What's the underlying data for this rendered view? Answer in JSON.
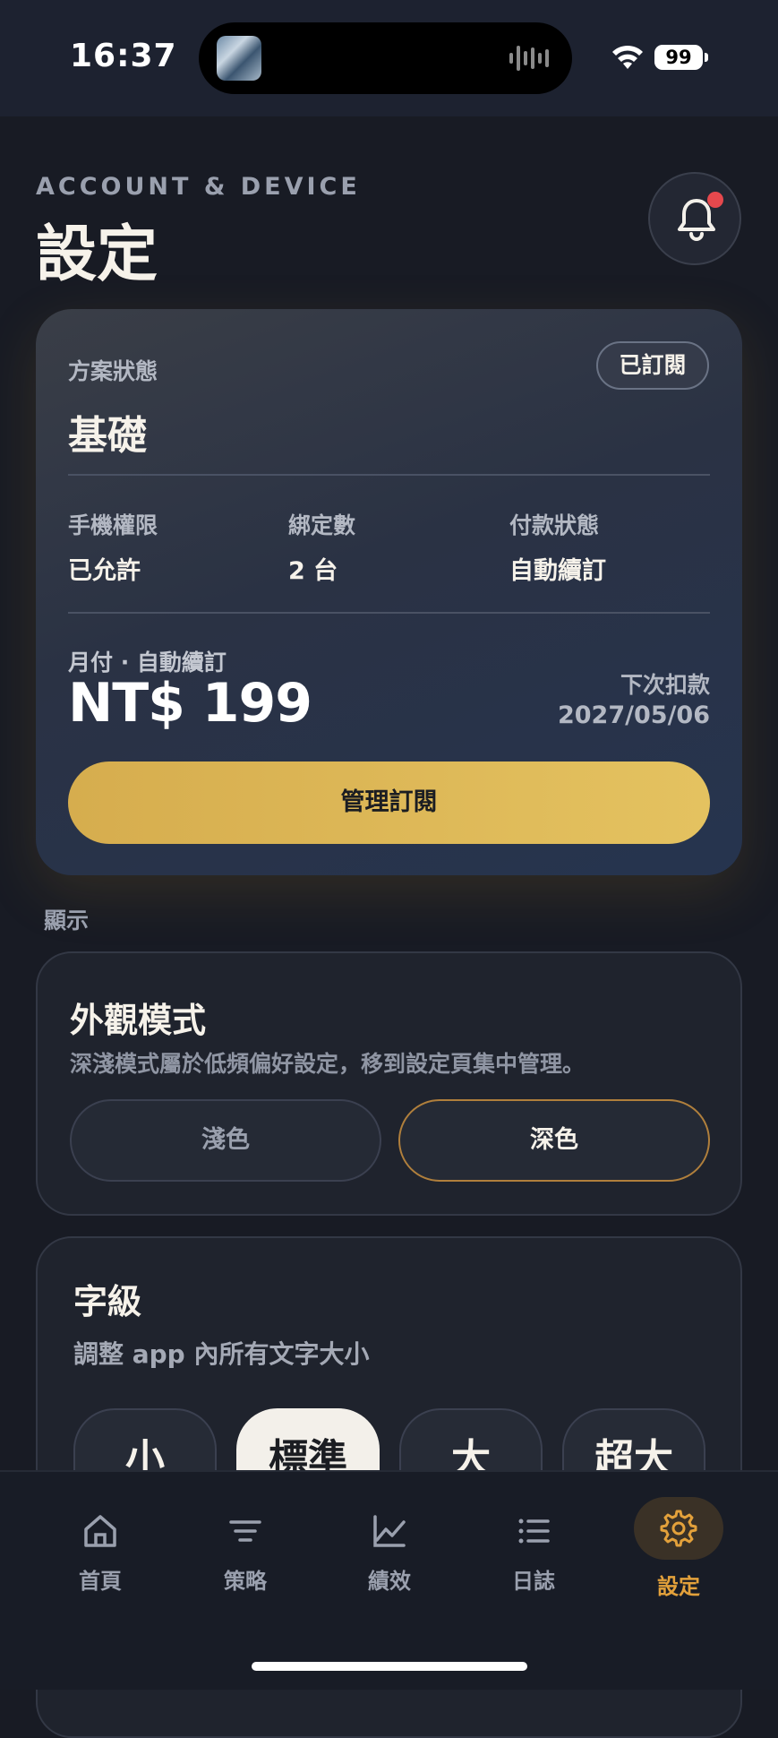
{
  "status_bar": {
    "time": "16:37",
    "battery": "99"
  },
  "header": {
    "kicker": "ACCOUNT & DEVICE",
    "title": "設定"
  },
  "plan": {
    "label": "方案狀態",
    "badge": "已訂閱",
    "name": "基礎",
    "stats": [
      {
        "label": "手機權限",
        "value": "已允許"
      },
      {
        "label": "綁定數",
        "value": "2 台"
      },
      {
        "label": "付款狀態",
        "value": "自動續訂"
      }
    ],
    "billing_cycle": "月付 · 自動續訂",
    "price": "NT$ 199",
    "next_charge_label": "下次扣款",
    "next_charge_date": "2027/05/06",
    "manage_button": "管理訂閱"
  },
  "display_section": {
    "label": "顯示",
    "appearance": {
      "title": "外觀模式",
      "subtitle": "深淺模式屬於低頻偏好設定，移到設定頁集中管理。",
      "options": [
        "淺色",
        "深色"
      ],
      "selected": "深色"
    },
    "font_size": {
      "title": "字級",
      "subtitle": "調整 app 內所有文字大小",
      "options": [
        "小",
        "標準",
        "大",
        "超大"
      ],
      "selected": "標準"
    }
  },
  "tabs": [
    {
      "label": "首頁",
      "icon": "home-icon"
    },
    {
      "label": "策略",
      "icon": "filter-icon"
    },
    {
      "label": "績效",
      "icon": "chart-line-icon"
    },
    {
      "label": "日誌",
      "icon": "list-icon"
    },
    {
      "label": "設定",
      "icon": "gear-icon",
      "active": true
    }
  ],
  "colors": {
    "accent": "#e3a13b",
    "button": "#e0b955",
    "background": "#181b24",
    "notification": "#e5484d"
  }
}
